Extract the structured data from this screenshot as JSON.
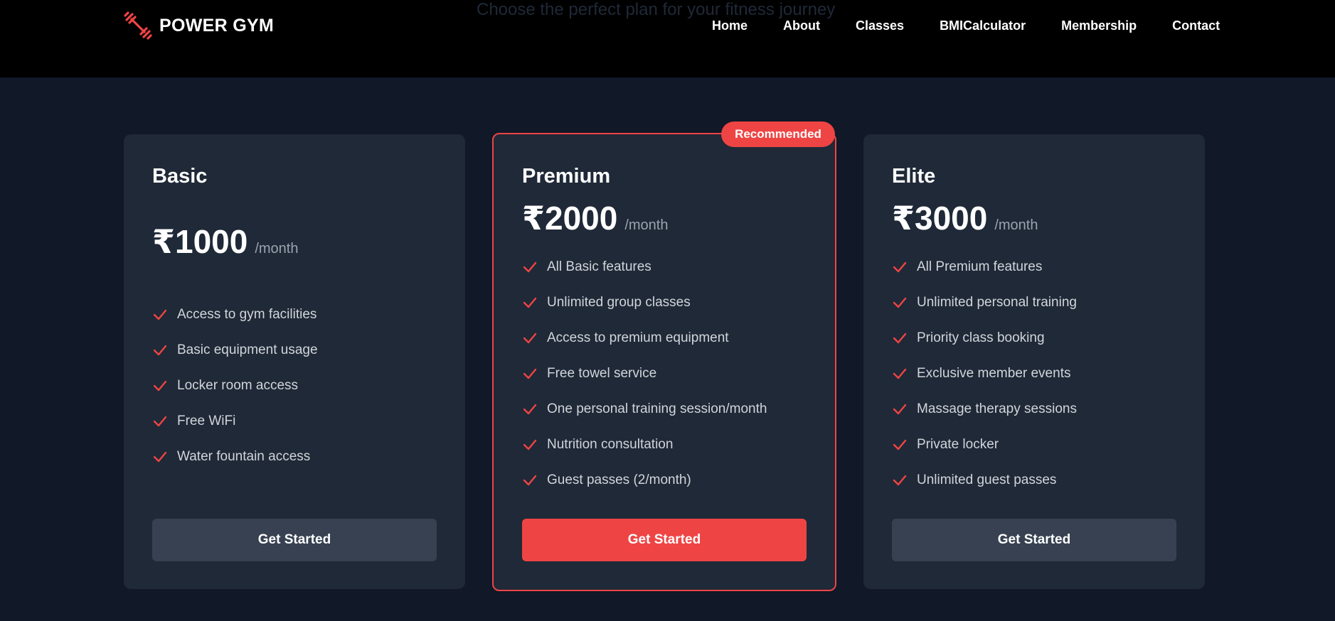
{
  "nav": {
    "brand": "POWER GYM",
    "brand_icon": "dumbbell-icon",
    "links": [
      "Home",
      "About",
      "Classes",
      "BMICalculator",
      "Membership",
      "Contact"
    ]
  },
  "hero": {
    "subtitle": "Choose the perfect plan for your fitness journey"
  },
  "colors": {
    "accent": "#ef4444",
    "card_bg": "#1f2937",
    "page_bg": "#111827",
    "button_gray": "#374151"
  },
  "plans": [
    {
      "name": "Basic",
      "price": "₹1000",
      "period": "/month",
      "features": [
        "Access to gym facilities",
        "Basic equipment usage",
        "Locker room access",
        "Free WiFi",
        "Water fountain access"
      ],
      "button": "Get Started"
    },
    {
      "name": "Premium",
      "badge": "Recommended",
      "price": "₹2000",
      "period": "/month",
      "features": [
        "All Basic features",
        "Unlimited group classes",
        "Access to premium equipment",
        "Free towel service",
        "One personal training session/month",
        "Nutrition consultation",
        "Guest passes (2/month)"
      ],
      "button": "Get Started"
    },
    {
      "name": "Elite",
      "price": "₹3000",
      "period": "/month",
      "features": [
        "All Premium features",
        "Unlimited personal training",
        "Priority class booking",
        "Exclusive member events",
        "Massage therapy sessions",
        "Private locker",
        "Unlimited guest passes"
      ],
      "button": "Get Started"
    }
  ]
}
